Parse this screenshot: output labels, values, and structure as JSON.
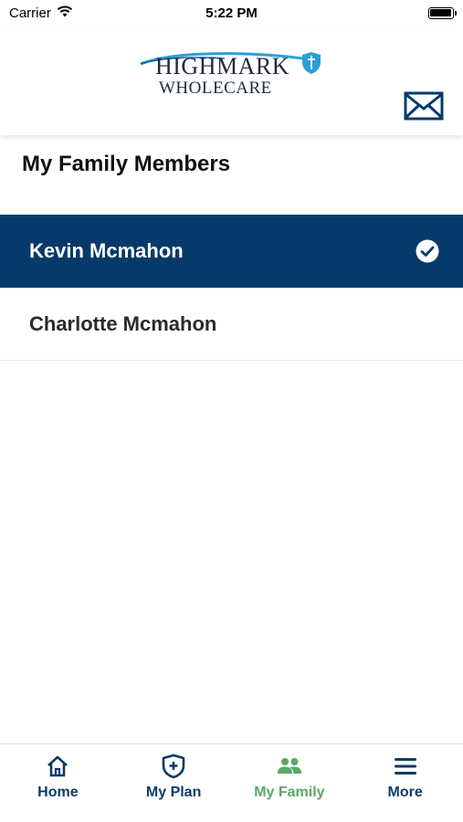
{
  "status_bar": {
    "carrier": "Carrier",
    "time": "5:22 PM"
  },
  "header": {
    "logo_line1": "HIGHMARK",
    "logo_line2": "WHOLECARE",
    "mail_icon": "envelope-icon"
  },
  "section": {
    "title": "My Family Members"
  },
  "family_members": [
    {
      "name": "Kevin Mcmahon",
      "selected": true
    },
    {
      "name": "Charlotte Mcmahon",
      "selected": false
    }
  ],
  "tabs": [
    {
      "label": "Home",
      "icon": "home-icon",
      "active": false
    },
    {
      "label": "My Plan",
      "icon": "shield-plus-icon",
      "active": false
    },
    {
      "label": "My Family",
      "icon": "people-icon",
      "active": true
    },
    {
      "label": "More",
      "icon": "menu-icon",
      "active": false
    }
  ],
  "colors": {
    "primary_navy": "#063a6b",
    "tab_active": "#5aa86a",
    "tab_inactive": "#0d3b66",
    "logo_blue": "#2a9fd6"
  }
}
